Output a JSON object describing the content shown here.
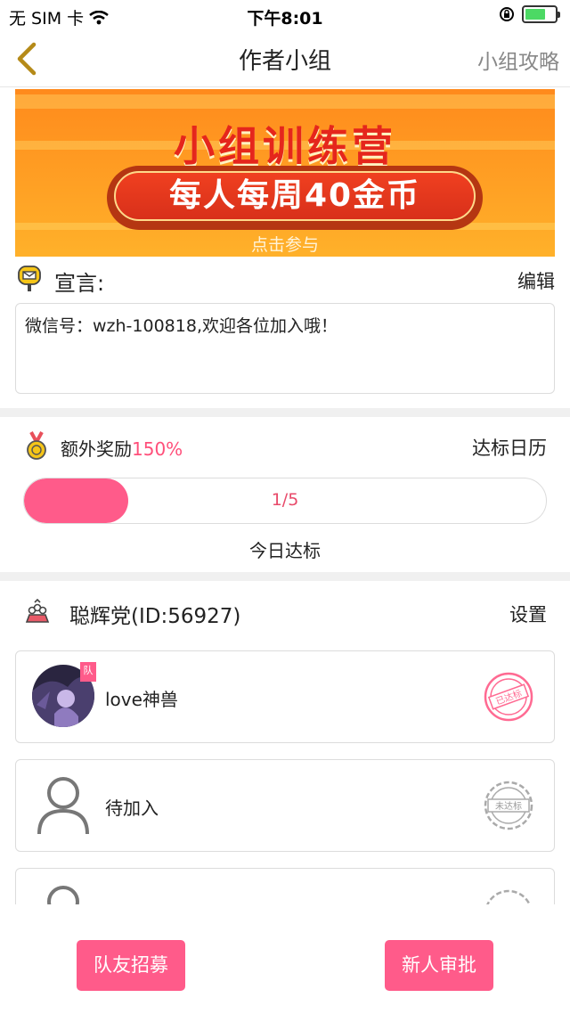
{
  "status_bar": {
    "carrier": "无 SIM 卡",
    "time": "下午8:01"
  },
  "nav": {
    "title": "作者小组",
    "right_label": "小组攻略"
  },
  "banner": {
    "title": "小组训练营",
    "pill_text": "每人每周40金币",
    "sub": "点击参与"
  },
  "declaration": {
    "label": "宣言:",
    "edit": "编辑",
    "text": "微信号：wzh-100818,欢迎各位加入哦！"
  },
  "reward": {
    "label": "额外奖励",
    "percent": "150%",
    "calendar": "达标日历",
    "progress_text": "1/5",
    "progress_fraction": 0.2,
    "today_label": "今日达标"
  },
  "team": {
    "label": "聪辉党(ID:56927)",
    "setting": "设置"
  },
  "members": [
    {
      "name": "love神兽",
      "badge": "队",
      "stamp": "已达标"
    },
    {
      "name": "待加入",
      "stamp": "未达标"
    }
  ],
  "bottom": {
    "recruit_button": "队友招募",
    "approve_button": "新人审批"
  },
  "colors": {
    "accent": "#ff5b8a",
    "banner": "#ff8a1c"
  }
}
